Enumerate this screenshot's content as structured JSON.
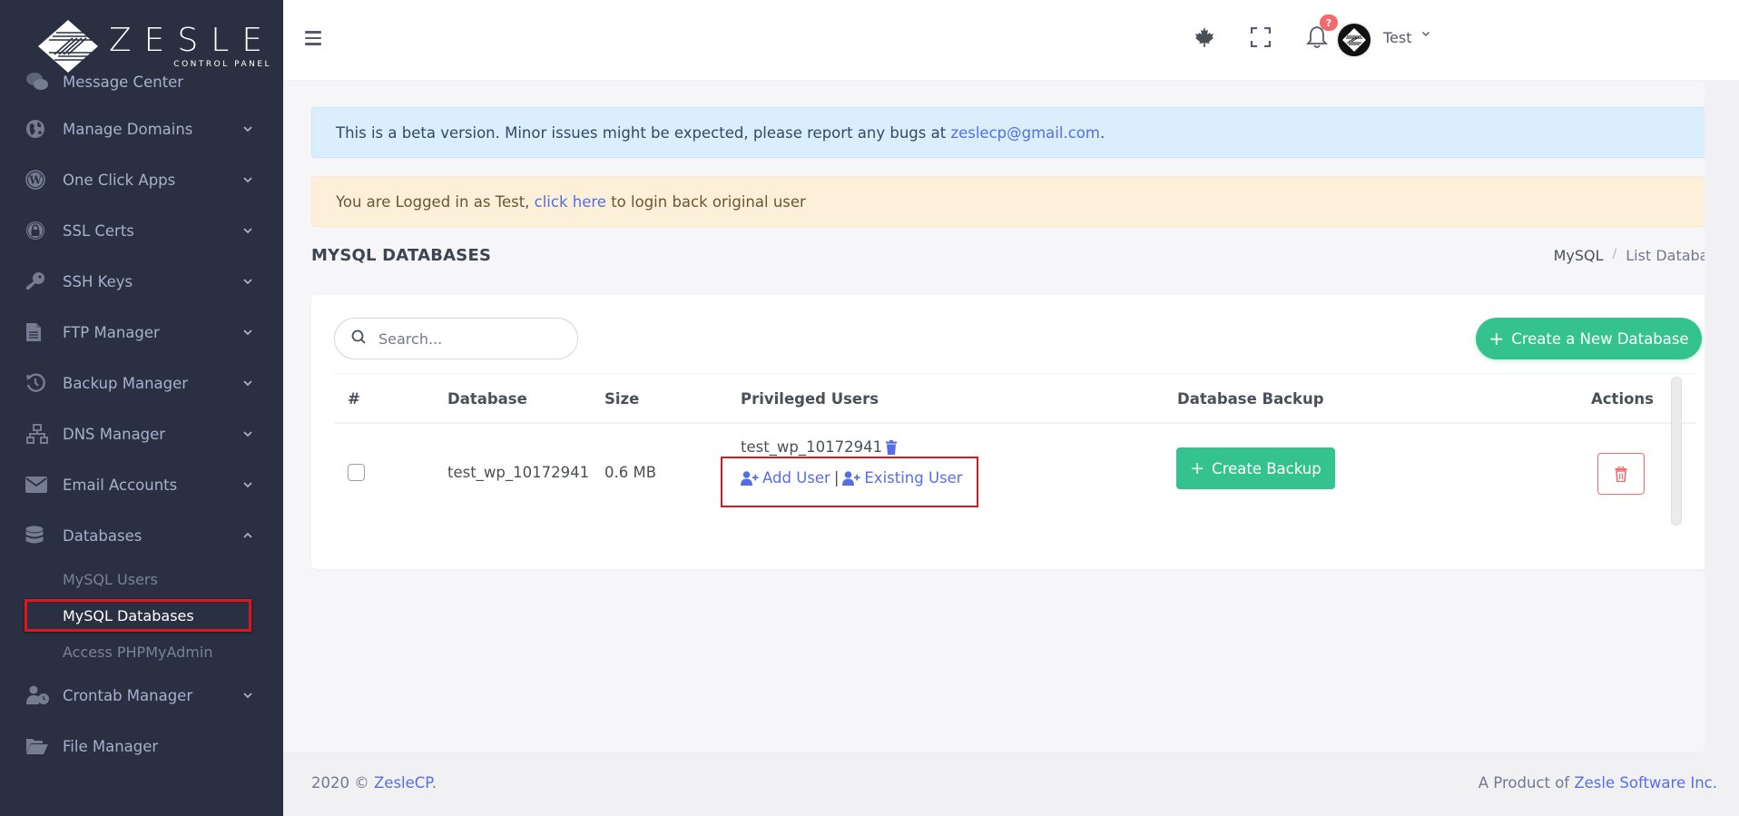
{
  "brand": {
    "title": "ZESLE",
    "subtitle": "CONTROL PANEL"
  },
  "sidebar": {
    "items": [
      {
        "label": "Message Center",
        "icon": "comments-icon",
        "has_chevron": false
      },
      {
        "label": "Manage Domains",
        "icon": "globe-icon",
        "has_chevron": true
      },
      {
        "label": "One Click Apps",
        "icon": "wordpress-icon",
        "has_chevron": true
      },
      {
        "label": "SSL Certs",
        "icon": "lock-icon",
        "has_chevron": true
      },
      {
        "label": "SSH Keys",
        "icon": "key-icon",
        "has_chevron": true
      },
      {
        "label": "FTP Manager",
        "icon": "file-icon",
        "has_chevron": true
      },
      {
        "label": "Backup Manager",
        "icon": "history-icon",
        "has_chevron": true
      },
      {
        "label": "DNS Manager",
        "icon": "network-icon",
        "has_chevron": true
      },
      {
        "label": "Email Accounts",
        "icon": "envelope-icon",
        "has_chevron": true
      },
      {
        "label": "Databases",
        "icon": "database-icon",
        "has_chevron": true,
        "expanded": true
      },
      {
        "label": "Crontab Manager",
        "icon": "user-clock-icon",
        "has_chevron": true
      },
      {
        "label": "File Manager",
        "icon": "folder-open-icon",
        "has_chevron": false
      }
    ],
    "databases_sub": [
      {
        "label": "MySQL Users",
        "active": false
      },
      {
        "label": "MySQL Databases",
        "active": true
      },
      {
        "label": "Access PHPMyAdmin",
        "active": false
      }
    ]
  },
  "topbar": {
    "notification_badge": "?",
    "user_name": "Test"
  },
  "alerts": {
    "info_text": "This is a beta version. Minor issues might be expected, please report any bugs at ",
    "info_link": "zeslecp@gmail.com",
    "info_suffix": ".",
    "warning_prefix": "You are Logged in as Test, ",
    "warning_link": "click here",
    "warning_suffix": " to login back original user"
  },
  "page": {
    "title": "MYSQL DATABASES",
    "breadcrumb": [
      "MySQL",
      "List Databases"
    ]
  },
  "toolbar": {
    "search_placeholder": "Search...",
    "search_value": "",
    "create_label": "Create a New Database"
  },
  "table": {
    "headers": [
      "#",
      "Database",
      "Size",
      "Privileged Users",
      "Database Backup",
      "Actions"
    ],
    "rows": [
      {
        "checked": false,
        "database": "test_wp_10172941",
        "size": "0.6 MB",
        "privileged_user": "test_wp_10172941",
        "add_user_label": "Add User",
        "separator": "|",
        "existing_user_label": "Existing User",
        "backup_label": "Create Backup"
      }
    ]
  },
  "footer": {
    "copyright_prefix": "2020 © ",
    "copyright_link": "ZesleCP",
    "copyright_suffix": ".",
    "product_prefix": "A Product of ",
    "product_link": "Zesle Software Inc."
  },
  "colors": {
    "sidebar_bg": "#2a3042",
    "accent": "#556ee6",
    "success": "#34c38f",
    "danger": "#f46a6a",
    "highlight": "#e0151b"
  }
}
